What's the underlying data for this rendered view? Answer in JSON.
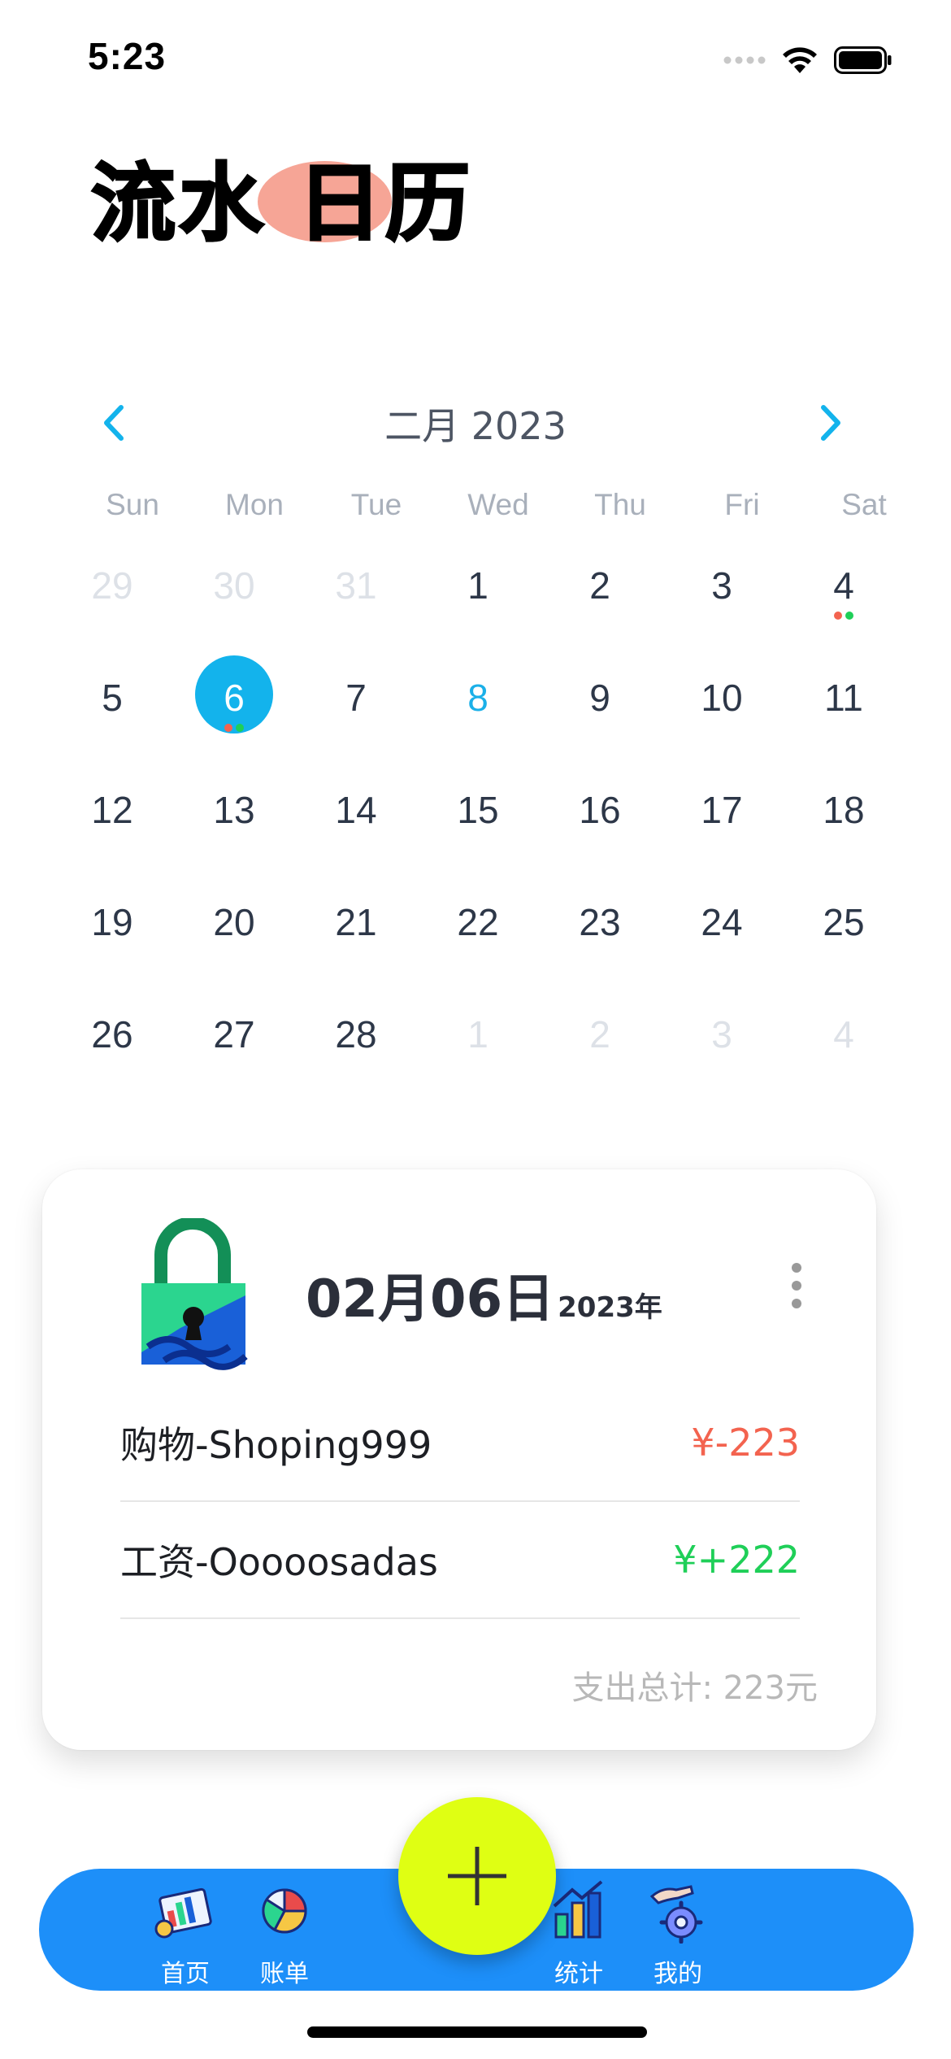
{
  "status_bar": {
    "time": "5:23"
  },
  "title": {
    "part1": "流水",
    "part2": "日历"
  },
  "calendar": {
    "month_label": "二月 2023",
    "weekdays": [
      "Sun",
      "Mon",
      "Tue",
      "Wed",
      "Thu",
      "Fri",
      "Sat"
    ],
    "weeks": [
      [
        {
          "d": "29",
          "muted": true
        },
        {
          "d": "30",
          "muted": true
        },
        {
          "d": "31",
          "muted": true
        },
        {
          "d": "1"
        },
        {
          "d": "2"
        },
        {
          "d": "3"
        },
        {
          "d": "4",
          "dots": [
            "#f3634f",
            "#1fcf58"
          ]
        }
      ],
      [
        {
          "d": "5"
        },
        {
          "d": "6",
          "selected": true,
          "dots": [
            "#f3634f",
            "#1fcf58"
          ]
        },
        {
          "d": "7"
        },
        {
          "d": "8",
          "accent": true
        },
        {
          "d": "9"
        },
        {
          "d": "10"
        },
        {
          "d": "11"
        }
      ],
      [
        {
          "d": "12"
        },
        {
          "d": "13"
        },
        {
          "d": "14"
        },
        {
          "d": "15"
        },
        {
          "d": "16"
        },
        {
          "d": "17"
        },
        {
          "d": "18"
        }
      ],
      [
        {
          "d": "19"
        },
        {
          "d": "20"
        },
        {
          "d": "21"
        },
        {
          "d": "22"
        },
        {
          "d": "23"
        },
        {
          "d": "24"
        },
        {
          "d": "25"
        }
      ],
      [
        {
          "d": "26"
        },
        {
          "d": "27"
        },
        {
          "d": "28"
        },
        {
          "d": "1",
          "muted": true
        },
        {
          "d": "2",
          "muted": true
        },
        {
          "d": "3",
          "muted": true
        },
        {
          "d": "4",
          "muted": true
        }
      ]
    ]
  },
  "detail": {
    "date": "02月06日",
    "year": "2023年",
    "transactions": [
      {
        "name": "购物-Shoping999",
        "amount": "¥-223",
        "type": "expense"
      },
      {
        "name": "工资-Ooooosadas",
        "amount": "¥+222",
        "type": "income"
      }
    ],
    "total": "支出总计: 223元"
  },
  "tabbar": {
    "home": "首页",
    "bills": "账单",
    "stats": "统计",
    "mine": "我的"
  },
  "colors": {
    "accent": "#13b3ec",
    "tabbar": "#1d8ff9",
    "fab": "#dfff13",
    "expense": "#f3634f",
    "income": "#1fcf58"
  }
}
